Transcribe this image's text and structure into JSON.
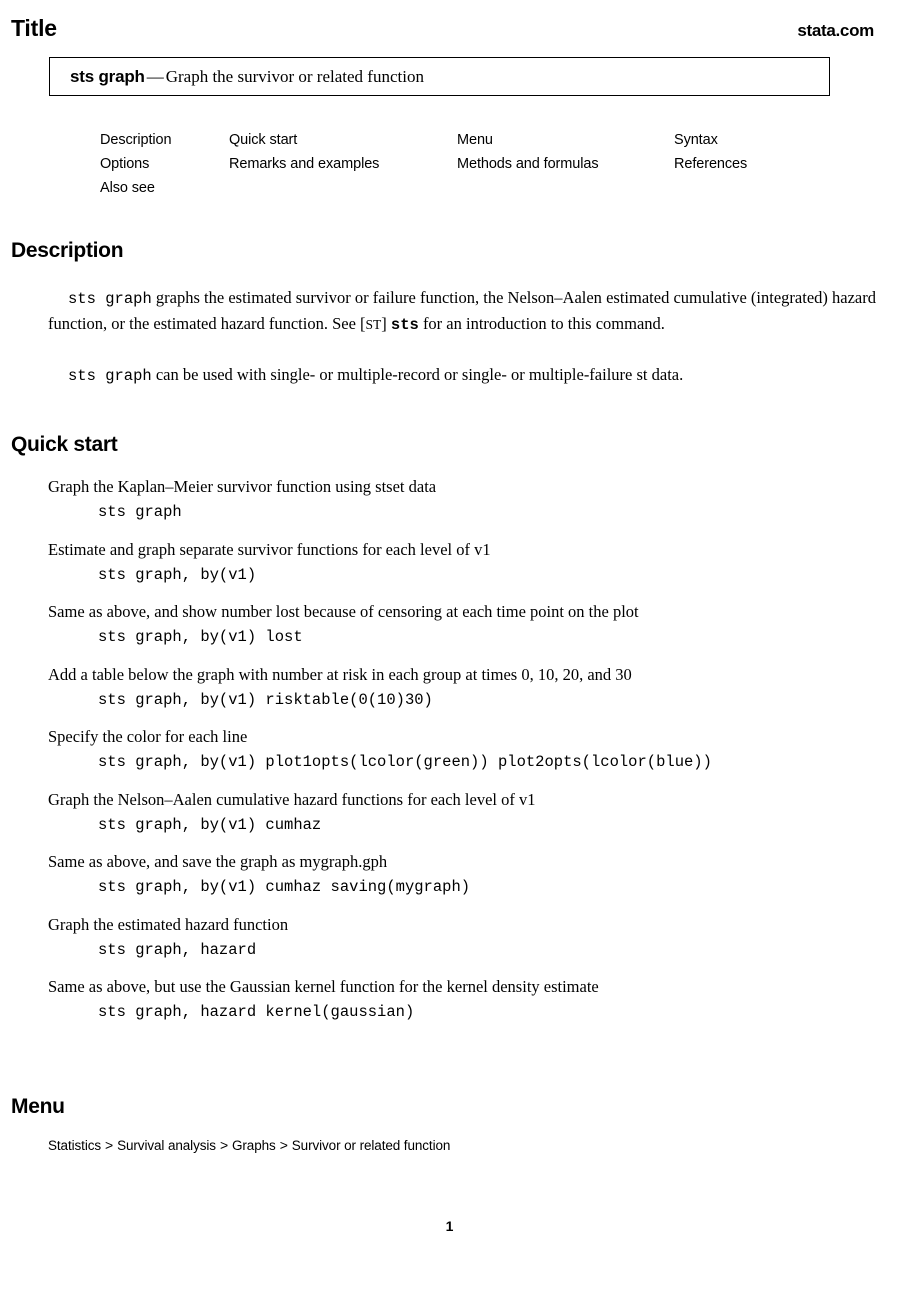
{
  "header": {
    "title": "Title",
    "site": "stata.com"
  },
  "title_box": {
    "command": "sts graph",
    "dash": "—",
    "description": "Graph the survivor or related function"
  },
  "nav_links": {
    "rows": [
      [
        "Description",
        "Quick start",
        "Menu",
        "Syntax"
      ],
      [
        "Options",
        "Remarks and examples",
        "Methods and formulas",
        "References"
      ],
      [
        "Also see",
        "",
        "",
        ""
      ]
    ]
  },
  "sections": {
    "description_heading": "Description",
    "quick_start_heading": "Quick start",
    "menu_heading": "Menu"
  },
  "description": {
    "paragraph1": {
      "cmd": "sts graph",
      "text_a": " graphs the estimated survivor or failure function, the Nelson–Aalen estimated cumulative (integrated) hazard function, or the estimated hazard function. See [",
      "bracket": "ST",
      "text_b": "] ",
      "ref": "sts",
      "text_c": " for an introduction to this command."
    },
    "paragraph2": {
      "cmd": "sts graph",
      "text": " can be used with single- or multiple-record or single- or multiple-failure st data."
    }
  },
  "quick_start": {
    "items": [
      {
        "desc": "Graph the Kaplan–Meier survivor function using stset data",
        "code": "sts graph"
      },
      {
        "desc": "Estimate and graph separate survivor functions for each level of v1",
        "code": "sts graph, by(v1)"
      },
      {
        "desc": "Same as above, and show number lost because of censoring at each time point on the plot",
        "code": "sts graph, by(v1) lost"
      },
      {
        "desc": "Add a table below the graph with number at risk in each group at times 0, 10, 20, and 30",
        "code": "sts graph, by(v1) risktable(0(10)30)"
      },
      {
        "desc": "Specify the color for each line",
        "code": "sts graph, by(v1) plot1opts(lcolor(green)) plot2opts(lcolor(blue))"
      },
      {
        "desc": "Graph the Nelson–Aalen cumulative hazard functions for each level of v1",
        "code": "sts graph, by(v1) cumhaz"
      },
      {
        "desc": "Same as above, and save the graph as mygraph.gph",
        "code": "sts graph, by(v1) cumhaz saving(mygraph)"
      },
      {
        "desc": "Graph the estimated hazard function",
        "code": "sts graph, hazard"
      },
      {
        "desc": "Same as above, but use the Gaussian kernel function for the kernel density estimate",
        "code": "sts graph, hazard kernel(gaussian)"
      }
    ],
    "inline_mono": [
      "stset",
      "v1",
      "mygraph.gph"
    ]
  },
  "menu": {
    "path_parts": [
      "Statistics",
      "Survival analysis",
      "Graphs",
      "Survivor or related function"
    ],
    "separator": ">"
  },
  "footer": {
    "page_number": "1"
  }
}
